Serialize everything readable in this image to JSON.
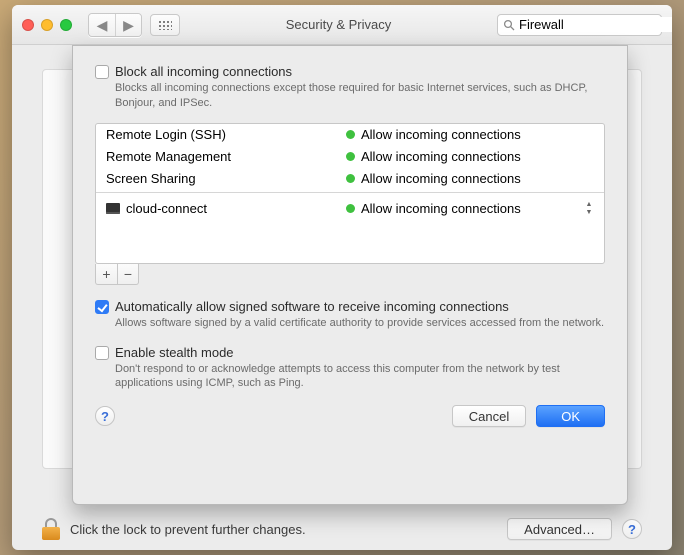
{
  "window": {
    "title": "Security & Privacy"
  },
  "search": {
    "value": "Firewall"
  },
  "block_all": {
    "checked": false,
    "label": "Block all incoming connections",
    "desc": "Blocks all incoming connections except those required for basic Internet services,  such as DHCP, Bonjour, and IPSec."
  },
  "services": [
    {
      "name": "Remote Login (SSH)",
      "status": "Allow incoming connections"
    },
    {
      "name": "Remote Management",
      "status": "Allow incoming connections"
    },
    {
      "name": "Screen Sharing",
      "status": "Allow incoming connections"
    }
  ],
  "apps": [
    {
      "name": "cloud-connect",
      "status": "Allow incoming connections"
    }
  ],
  "auto_allow": {
    "checked": true,
    "label": "Automatically allow signed software to receive incoming connections",
    "desc": "Allows software signed by a valid certificate authority to provide services accessed from the network."
  },
  "stealth": {
    "checked": false,
    "label": "Enable stealth mode",
    "desc": "Don't respond to or acknowledge attempts to access this computer from the network by test applications using ICMP, such as Ping."
  },
  "buttons": {
    "cancel": "Cancel",
    "ok": "OK",
    "advanced": "Advanced…"
  },
  "lock_msg": "Click the lock to prevent further changes."
}
